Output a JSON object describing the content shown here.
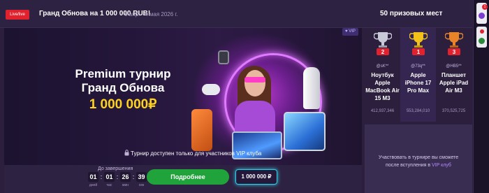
{
  "header": {
    "live_badge": "Live/live",
    "title": "Гранд Обнова на 1 000 000 RUB!",
    "dates": "6 апр. - 4 мая 2026 г.",
    "prize_places": "50 призовых мест"
  },
  "banner": {
    "vip_chip": "♥ VIP",
    "headline_line1": "Premium турнир",
    "headline_line2": "Гранд Обнова",
    "headline_amount": "1 000 000₽",
    "vip_only_text": "Турнир доступен только для участников VIP клуба"
  },
  "countdown": {
    "label": "До завершения",
    "days": "01",
    "hours": "01",
    "minutes": "26",
    "seconds": "39",
    "days_unit": "дней",
    "hours_unit": "час",
    "minutes_unit": "мин",
    "seconds_unit": "сек"
  },
  "actions": {
    "more_button": "Подробнее",
    "prize_pool": "1 000 000 ₽"
  },
  "leaders": [
    {
      "place": "2",
      "name": "@sK**",
      "prize": "Ноутбук Apple MacBook Air 15 M3",
      "score": "412,937,346",
      "color": "#c7c9d6"
    },
    {
      "place": "1",
      "name": "@73q**",
      "prize": "Apple iPhone 17 Pro Max",
      "score": "553,284,010",
      "color": "#f2c21b"
    },
    {
      "place": "3",
      "name": "@HB5**",
      "prize": "Планшет Apple iPad Air M3",
      "score": "370,525,725",
      "color": "#e8832a"
    }
  ],
  "join": {
    "text_before": "Участвовать в турнире вы сможете после вступления в ",
    "vip_link": "VIP клуб"
  },
  "sidebar": {
    "badge": "1"
  },
  "colors": {
    "accent_green": "#1fa33a",
    "gold": "#ffd21f",
    "live_red": "#e0222e"
  }
}
